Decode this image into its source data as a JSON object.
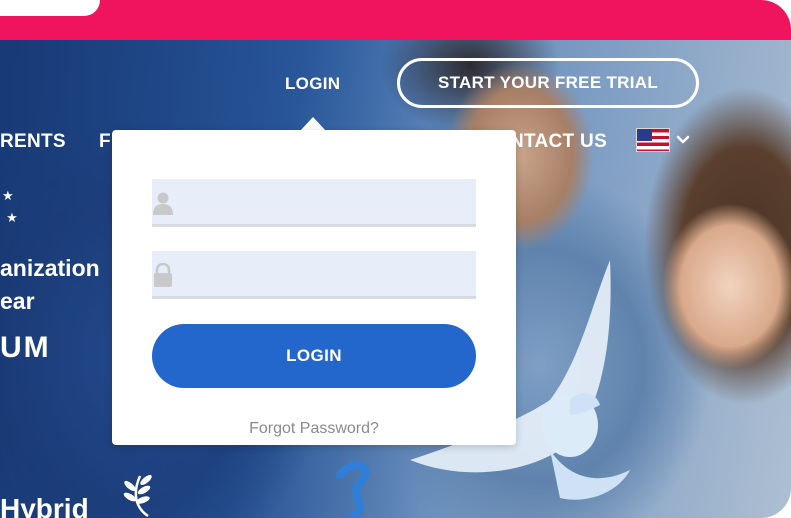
{
  "header": {
    "login_label": "LOGIN",
    "trial_button": "START YOUR FREE TRIAL",
    "nav_items": [
      "RENTS",
      "F",
      "NTACT US"
    ],
    "language_icon": "us-flag-icon",
    "language_toggle_icon": "chevron-down-icon"
  },
  "hero": {
    "line1": "anization",
    "line2": "ear",
    "line3": "UM",
    "bottom_text": "Hybrid"
  },
  "login_dropdown": {
    "username": {
      "icon": "user-icon",
      "value": "",
      "placeholder": ""
    },
    "password": {
      "icon": "lock-icon",
      "value": "",
      "placeholder": ""
    },
    "submit_label": "LOGIN",
    "forgot_link": "Forgot Password?"
  },
  "colors": {
    "brand_pink": "#f0145f",
    "button_blue": "#2467cc",
    "field_bg": "#e8eef9"
  }
}
